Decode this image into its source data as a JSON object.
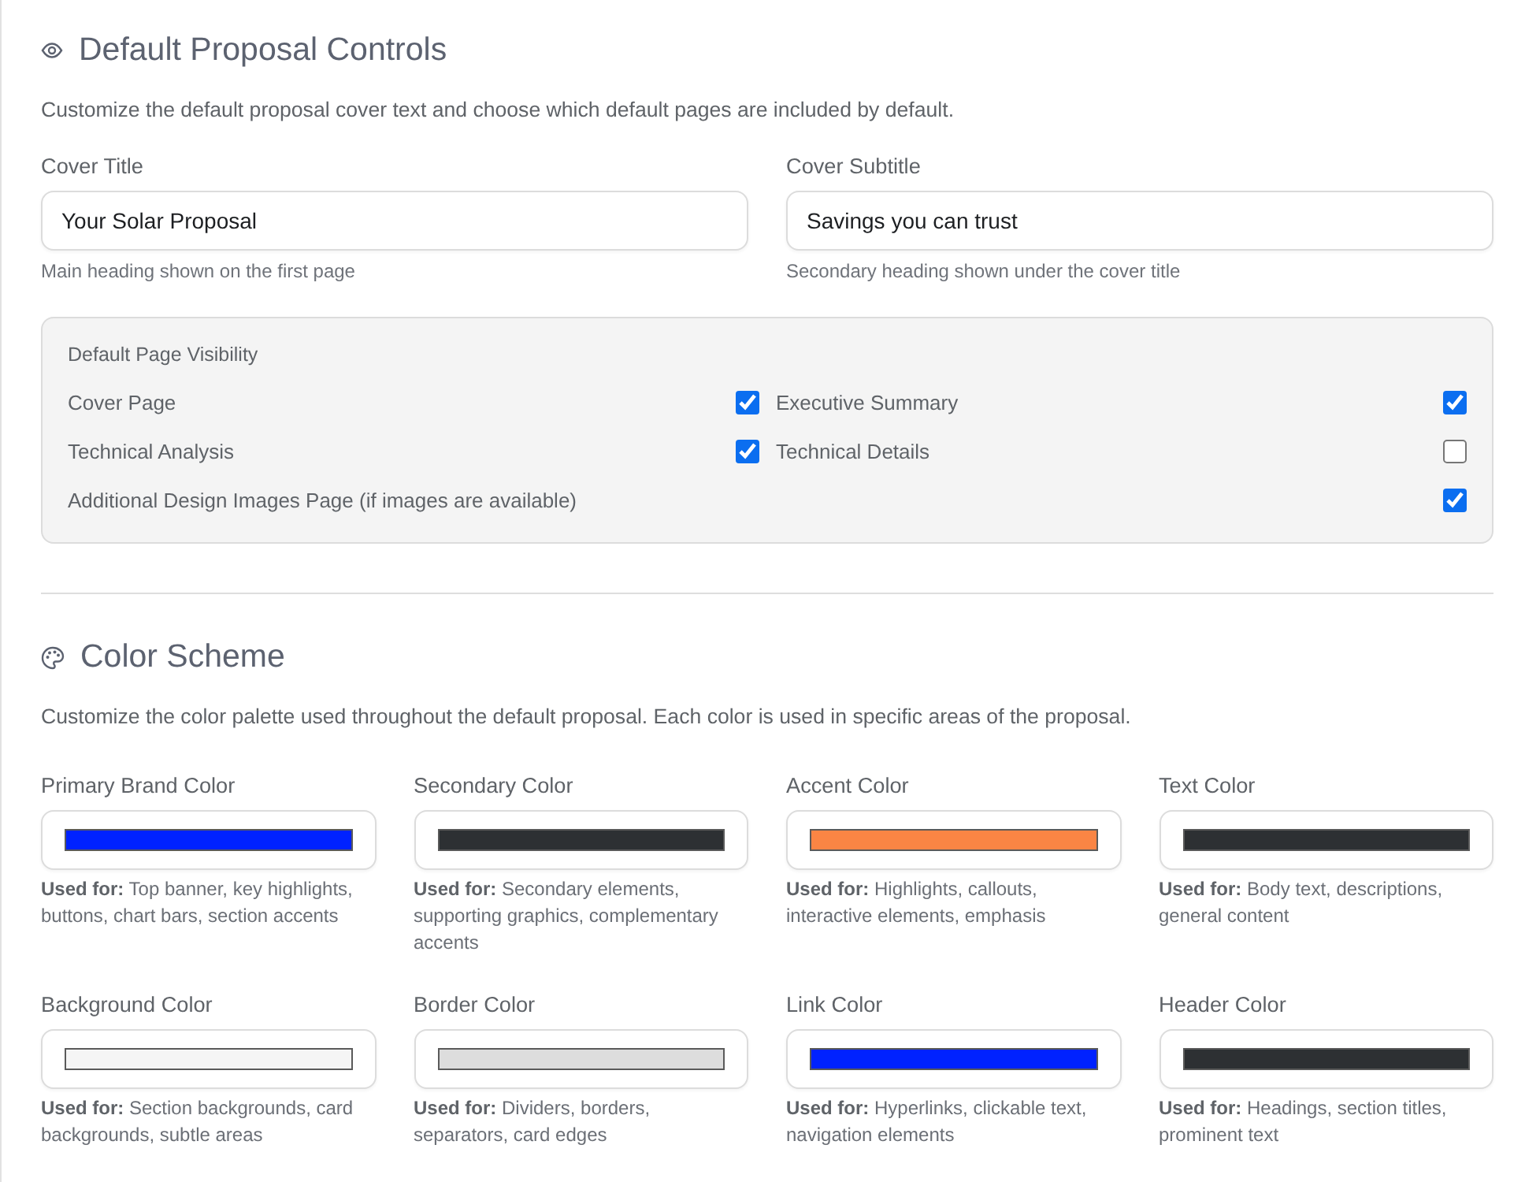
{
  "proposal_controls": {
    "title": "Default Proposal Controls",
    "description": "Customize the default proposal cover text and choose which default pages are included by default.",
    "fields": [
      {
        "label": "Cover Title",
        "value": "Your Solar Proposal",
        "hint": "Main heading shown on the first page"
      },
      {
        "label": "Cover Subtitle",
        "value": "Savings you can trust",
        "hint": "Secondary heading shown under the cover title"
      }
    ],
    "page_visibility": {
      "title": "Default Page Visibility",
      "items": [
        {
          "label": "Cover Page",
          "checked": true
        },
        {
          "label": "Executive Summary",
          "checked": true
        },
        {
          "label": "Technical Analysis",
          "checked": true
        },
        {
          "label": "Technical Details",
          "checked": false
        },
        {
          "label": "Additional Design Images Page (if images are available)",
          "checked": true
        }
      ]
    }
  },
  "color_scheme": {
    "title": "Color Scheme",
    "description": "Customize the color palette used throughout the default proposal. Each color is used in specific areas of the proposal.",
    "colors": [
      {
        "label": "Primary Brand Color",
        "color": "#0022ff",
        "usage": "**Used for:** Top banner, key highlights, buttons, chart bars, section accents"
      },
      {
        "label": "Secondary Color",
        "color": "#2d3033",
        "usage": "**Used for:** Secondary elements, supporting graphics, complementary accents"
      },
      {
        "label": "Accent Color",
        "color": "#fa8544",
        "usage": "**Used for:** Highlights, callouts, interactive elements, emphasis"
      },
      {
        "label": "Text Color",
        "color": "#2d3033",
        "usage": "**Used for:** Body text, descriptions, general content"
      },
      {
        "label": "Background Color",
        "color": "#f5f5f5",
        "usage": "**Used for:** Section backgrounds, card backgrounds, subtle areas"
      },
      {
        "label": "Border Color",
        "color": "#dddddd",
        "usage": "**Used for:** Dividers, borders, separators, card edges"
      },
      {
        "label": "Link Color",
        "color": "#0022ff",
        "usage": "**Used for:** Hyperlinks, clickable text, navigation elements"
      },
      {
        "label": "Header Color",
        "color": "#2d3033",
        "usage": "**Used for:** Headings, section titles, prominent text"
      }
    ]
  }
}
